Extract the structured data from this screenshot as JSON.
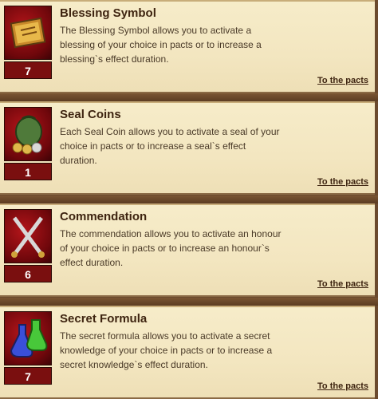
{
  "items": [
    {
      "title": "Blessing Symbol",
      "description": "The Blessing Symbol allows you to activate a blessing of your choice in pacts or to increase a blessing`s effect duration.",
      "count": "7",
      "link": "To the pacts",
      "icon": "book-icon"
    },
    {
      "title": "Seal Coins",
      "description": "Each Seal Coin allows you to activate a seal of your choice in pacts or to increase a seal`s effect duration.",
      "count": "1",
      "link": "To the pacts",
      "icon": "coin-bag-icon"
    },
    {
      "title": "Commendation",
      "description": "The commendation allows you to activate an honour of your choice in pacts or to increase an honour`s effect duration.",
      "count": "6",
      "link": "To the pacts",
      "icon": "crossed-swords-icon"
    },
    {
      "title": "Secret Formula",
      "description": "The secret formula allows you to activate a secret knowledge of your choice in pacts or to increase a secret knowledge`s effect duration.",
      "count": "7",
      "link": "To the pacts",
      "icon": "potion-flasks-icon"
    }
  ]
}
